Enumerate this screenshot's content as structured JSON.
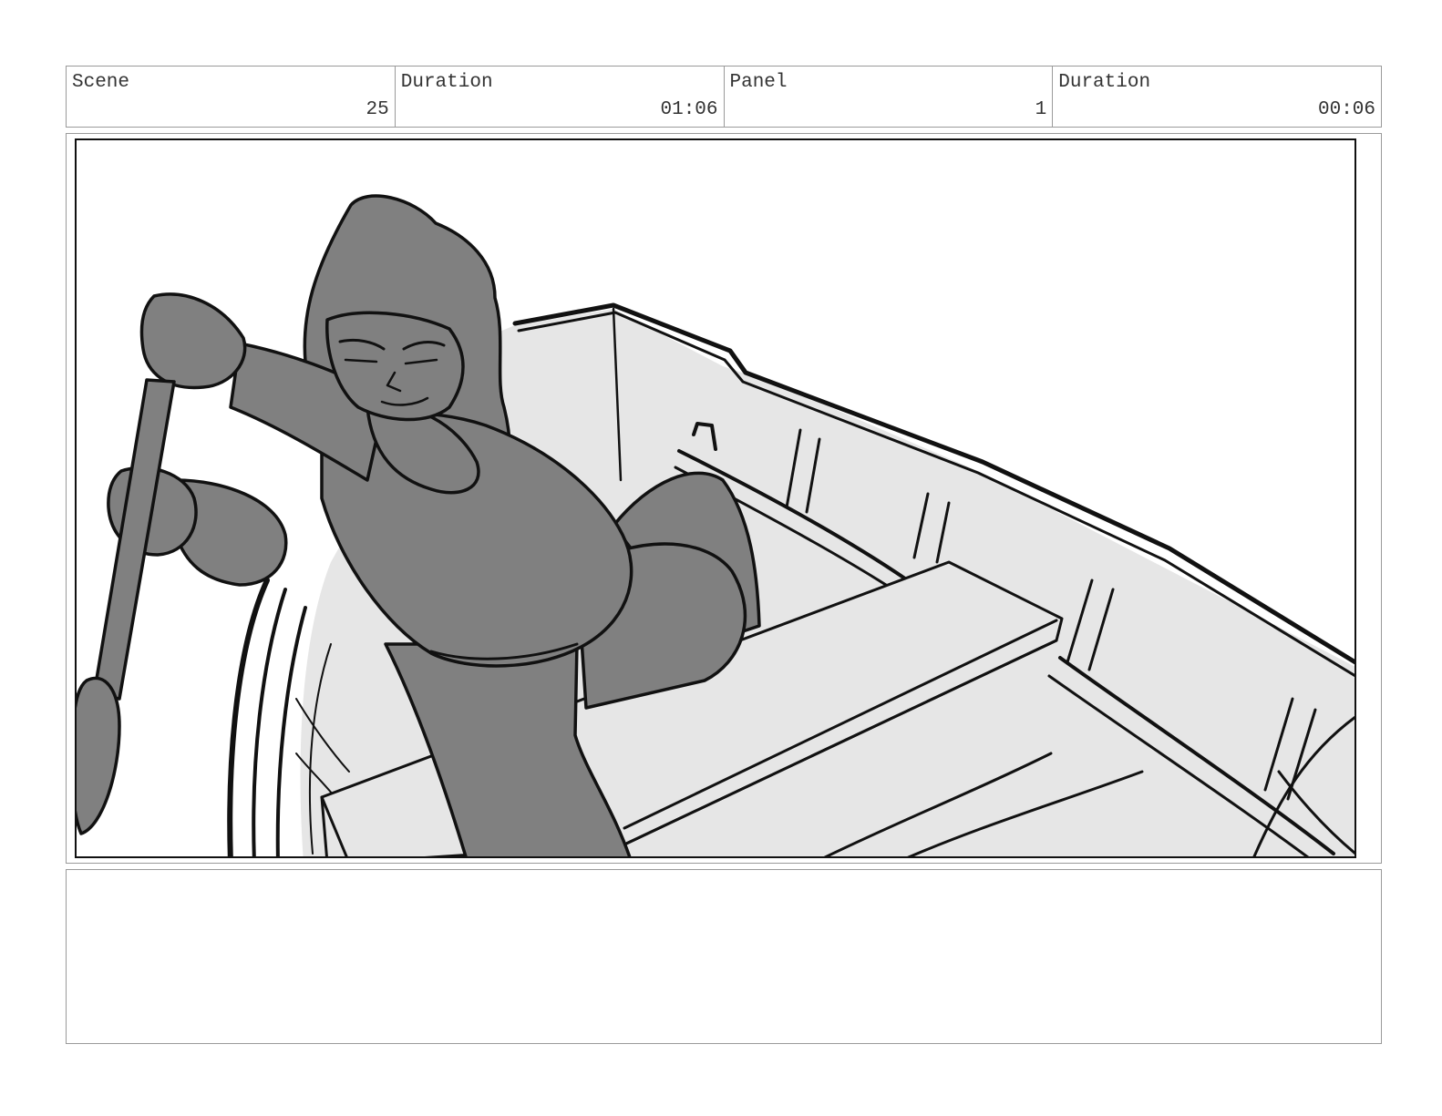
{
  "header": {
    "scene": {
      "label": "Scene",
      "value": "25"
    },
    "scene_duration": {
      "label": "Duration",
      "value": "01:06"
    },
    "panel": {
      "label": "Panel",
      "value": "1"
    },
    "panel_duration": {
      "label": "Duration",
      "value": "00:06"
    }
  },
  "colors": {
    "figure": "#808080",
    "boat": "#e6e6e6",
    "ink": "#111111",
    "rule": "#9a9a9a"
  },
  "notes": {
    "text": ""
  }
}
